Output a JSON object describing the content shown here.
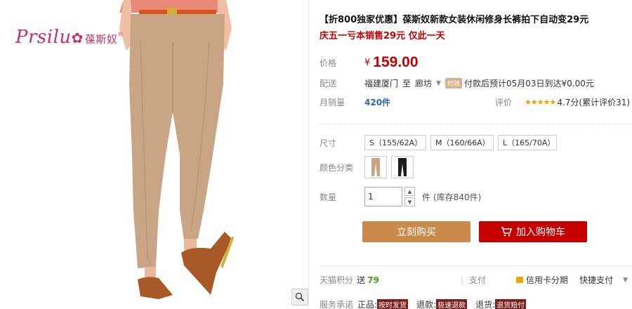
{
  "brand": {
    "logo_text": "Prsilu",
    "logo_cn": "葆斯奴",
    "logo_mark": "®"
  },
  "product": {
    "title": "【折800独家优惠】葆斯奴新款女装休闲修身长裤拍下自动变29元",
    "subtitle": "庆五一亏本销售29元 仅此一天"
  },
  "price": {
    "label": "价格",
    "currency": "¥",
    "value": "159.00"
  },
  "shipping": {
    "label": "配送",
    "from": "福建厦门",
    "to_word": "至",
    "destination": "廊坊",
    "badge": "时效",
    "note": "付款后预计05月03日到达¥0.00元"
  },
  "sales": {
    "label": "月销量",
    "count": "420件"
  },
  "rating": {
    "label": "评价",
    "stars": "★★★★★",
    "text": "4.7分(累计评价31)"
  },
  "sizes": {
    "label": "尺寸",
    "options": [
      "S（155/62A）",
      "M（160/66A）",
      "L（165/70A）"
    ]
  },
  "colors": {
    "label": "颜色分类",
    "swatches": [
      "#c9a586",
      "#1c1c22"
    ]
  },
  "quantity": {
    "label": "数量",
    "value": "1",
    "unit": "件",
    "stock": "(库存840件)"
  },
  "buttons": {
    "buy_now": "立刻购买",
    "add_to_cart": "加入购物车"
  },
  "credit": {
    "label": "天猫积分",
    "prefix": "送",
    "points": "79",
    "pay_label": "支付",
    "card_label": "信用卡分期",
    "quick_label": "快捷支付"
  },
  "service": {
    "label": "服务承诺",
    "items": [
      {
        "name": "正品:",
        "tag": "按时发货"
      },
      {
        "name": "退款:",
        "tag": "极速退款"
      },
      {
        "name": "退货:",
        "tag": "退货赔付"
      }
    ]
  }
}
